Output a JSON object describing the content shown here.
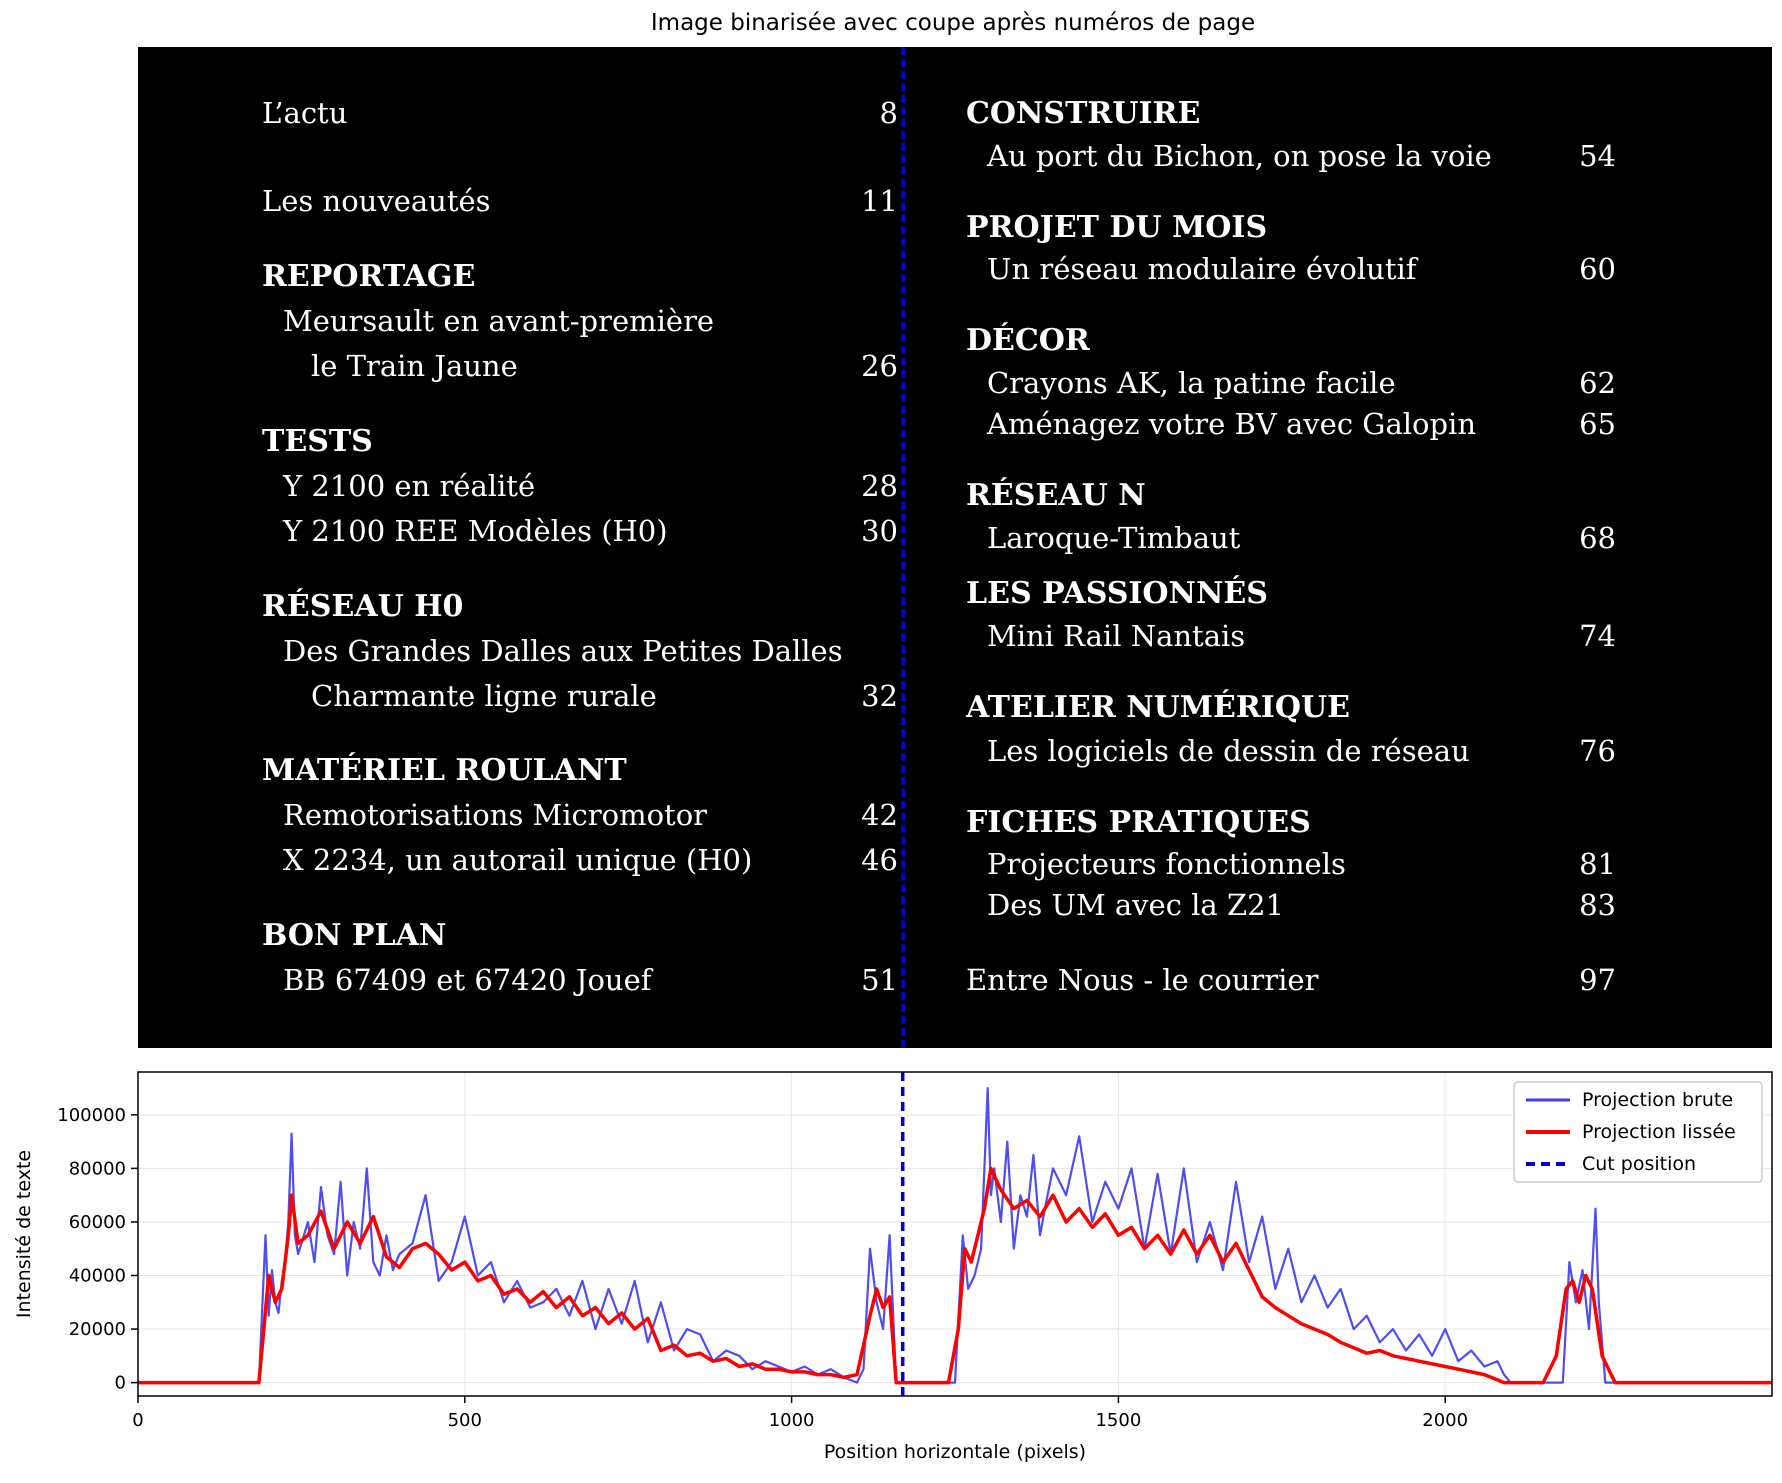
{
  "figure": {
    "title": "Image binarisée avec coupe après numéros de page"
  },
  "toc": {
    "left": [
      {
        "text": "L’actu",
        "page": "8",
        "kind": "item0"
      },
      {
        "text": "Les nouveautés",
        "page": "11",
        "kind": "item0"
      },
      {
        "text": "REPORTAGE",
        "page": "",
        "kind": "head"
      },
      {
        "text": "Meursault en avant-première",
        "page": "",
        "kind": "item1"
      },
      {
        "text": "le Train Jaune",
        "page": "26",
        "kind": "item2"
      },
      {
        "text": "TESTS",
        "page": "",
        "kind": "head"
      },
      {
        "text": "Y 2100 en réalité",
        "page": "28",
        "kind": "item1"
      },
      {
        "text": "Y 2100 REE Modèles (H0)",
        "page": "30",
        "kind": "item1"
      },
      {
        "text": "RÉSEAU H0",
        "page": "",
        "kind": "head"
      },
      {
        "text": "Des Grandes Dalles aux Petites Dalles",
        "page": "",
        "kind": "item1"
      },
      {
        "text": "Charmante ligne rurale",
        "page": "32",
        "kind": "item2"
      },
      {
        "text": "MATÉRIEL ROULANT",
        "page": "",
        "kind": "head"
      },
      {
        "text": "Remotorisations Micromotor",
        "page": "42",
        "kind": "item1"
      },
      {
        "text": "X 2234, un autorail unique (H0)",
        "page": "46",
        "kind": "item1"
      },
      {
        "text": "BON PLAN",
        "page": "",
        "kind": "head"
      },
      {
        "text": "BB 67409 et 67420 Jouef",
        "page": "51",
        "kind": "item1"
      }
    ],
    "right": [
      {
        "text": "CONSTRUIRE",
        "page": "",
        "kind": "head"
      },
      {
        "text": "Au port du Bichon, on pose la voie",
        "page": "54",
        "kind": "item1"
      },
      {
        "text": "PROJET DU MOIS",
        "page": "",
        "kind": "head"
      },
      {
        "text": "Un réseau modulaire évolutif",
        "page": "60",
        "kind": "item1"
      },
      {
        "text": "DÉCOR",
        "page": "",
        "kind": "head"
      },
      {
        "text": "Crayons AK, la patine facile",
        "page": "62",
        "kind": "item1"
      },
      {
        "text": "Aménagez votre BV avec Galopin",
        "page": "65",
        "kind": "item1"
      },
      {
        "text": "RÉSEAU N",
        "page": "",
        "kind": "head"
      },
      {
        "text": "Laroque-Timbaut",
        "page": "68",
        "kind": "item1"
      },
      {
        "text": "LES PASSIONNÉS",
        "page": "",
        "kind": "head"
      },
      {
        "text": "Mini Rail Nantais",
        "page": "74",
        "kind": "item1"
      },
      {
        "text": "ATELIER NUMÉRIQUE",
        "page": "",
        "kind": "head"
      },
      {
        "text": "Les logiciels de dessin de réseau",
        "page": "76",
        "kind": "item1"
      },
      {
        "text": "FICHES PRATIQUES",
        "page": "",
        "kind": "head"
      },
      {
        "text": "Projecteurs fonctionnels",
        "page": "81",
        "kind": "item1"
      },
      {
        "text": "Des UM avec la Z21",
        "page": "83",
        "kind": "item1"
      },
      {
        "text": "Entre Nous - le courrier",
        "page": "97",
        "kind": "item0"
      }
    ]
  },
  "chart_data": {
    "type": "line",
    "title": "",
    "xlabel": "Position horizontale (pixels)",
    "ylabel": "Intensité de texte",
    "xlim": [
      0,
      2500
    ],
    "ylim": [
      -5000,
      116000
    ],
    "xticks": [
      0,
      500,
      1000,
      1500,
      2000
    ],
    "yticks": [
      0,
      20000,
      40000,
      60000,
      80000,
      100000
    ],
    "grid": true,
    "legend_position": "top-right",
    "cut_position": 1170,
    "series": [
      {
        "name": "Projection brute",
        "color": "#3b3bf0",
        "x": [
          0,
          170,
          185,
          195,
          200,
          205,
          210,
          215,
          220,
          225,
          230,
          235,
          240,
          245,
          250,
          260,
          270,
          280,
          290,
          300,
          310,
          320,
          330,
          340,
          350,
          360,
          370,
          380,
          390,
          400,
          420,
          440,
          460,
          480,
          500,
          520,
          540,
          560,
          580,
          600,
          620,
          640,
          660,
          680,
          700,
          720,
          740,
          760,
          780,
          800,
          820,
          840,
          860,
          880,
          900,
          920,
          940,
          960,
          980,
          1000,
          1020,
          1040,
          1060,
          1080,
          1100,
          1110,
          1120,
          1130,
          1140,
          1150,
          1160,
          1170,
          1200,
          1250,
          1262,
          1270,
          1280,
          1290,
          1300,
          1305,
          1310,
          1320,
          1330,
          1340,
          1350,
          1360,
          1370,
          1380,
          1390,
          1400,
          1420,
          1440,
          1460,
          1480,
          1500,
          1520,
          1540,
          1560,
          1580,
          1600,
          1620,
          1640,
          1660,
          1680,
          1700,
          1720,
          1740,
          1760,
          1780,
          1800,
          1820,
          1840,
          1860,
          1880,
          1900,
          1920,
          1940,
          1960,
          1980,
          2000,
          2020,
          2040,
          2060,
          2080,
          2090,
          2100,
          2150,
          2180,
          2190,
          2200,
          2210,
          2220,
          2230,
          2235,
          2245,
          2260,
          2500
        ],
        "y": [
          0,
          0,
          0,
          55000,
          25000,
          42000,
          30000,
          26000,
          38000,
          45000,
          60000,
          93000,
          55000,
          48000,
          52000,
          60000,
          45000,
          73000,
          55000,
          48000,
          75000,
          40000,
          60000,
          50000,
          80000,
          45000,
          40000,
          55000,
          42000,
          48000,
          52000,
          70000,
          38000,
          45000,
          62000,
          40000,
          45000,
          30000,
          38000,
          28000,
          30000,
          35000,
          25000,
          38000,
          20000,
          35000,
          22000,
          38000,
          15000,
          30000,
          12000,
          20000,
          18000,
          8000,
          12000,
          10000,
          5000,
          8000,
          6000,
          4000,
          6000,
          3000,
          5000,
          2000,
          0,
          5000,
          50000,
          30000,
          20000,
          55000,
          0,
          0,
          0,
          0,
          55000,
          35000,
          40000,
          50000,
          110000,
          70000,
          80000,
          60000,
          90000,
          50000,
          70000,
          62000,
          85000,
          55000,
          68000,
          80000,
          70000,
          92000,
          60000,
          75000,
          65000,
          80000,
          50000,
          78000,
          48000,
          80000,
          45000,
          60000,
          42000,
          75000,
          45000,
          62000,
          35000,
          50000,
          30000,
          40000,
          28000,
          35000,
          20000,
          25000,
          15000,
          20000,
          12000,
          18000,
          10000,
          20000,
          8000,
          12000,
          6000,
          8000,
          3000,
          0,
          0,
          0,
          45000,
          30000,
          42000,
          20000,
          65000,
          30000,
          0,
          0,
          0
        ]
      },
      {
        "name": "Projection lissée",
        "color": "#ff0000",
        "x": [
          0,
          170,
          185,
          200,
          210,
          220,
          230,
          235,
          245,
          260,
          280,
          300,
          320,
          340,
          360,
          380,
          400,
          420,
          440,
          460,
          480,
          500,
          520,
          540,
          560,
          580,
          600,
          620,
          640,
          660,
          680,
          700,
          720,
          740,
          760,
          780,
          800,
          820,
          840,
          860,
          880,
          900,
          920,
          940,
          960,
          980,
          1000,
          1020,
          1040,
          1060,
          1080,
          1100,
          1120,
          1130,
          1140,
          1150,
          1160,
          1170,
          1200,
          1240,
          1255,
          1265,
          1275,
          1285,
          1295,
          1305,
          1320,
          1340,
          1360,
          1380,
          1400,
          1420,
          1440,
          1460,
          1480,
          1500,
          1520,
          1540,
          1560,
          1580,
          1600,
          1620,
          1640,
          1660,
          1680,
          1700,
          1720,
          1740,
          1760,
          1780,
          1800,
          1820,
          1840,
          1860,
          1880,
          1900,
          1920,
          1940,
          1960,
          1980,
          2000,
          2020,
          2040,
          2060,
          2080,
          2090,
          2150,
          2170,
          2185,
          2195,
          2205,
          2215,
          2225,
          2240,
          2260,
          2500
        ],
        "y": [
          0,
          0,
          0,
          40000,
          30000,
          35000,
          55000,
          70000,
          52000,
          55000,
          64000,
          50000,
          60000,
          52000,
          62000,
          47000,
          43000,
          50000,
          52000,
          48000,
          42000,
          45000,
          38000,
          40000,
          33000,
          35000,
          30000,
          34000,
          28000,
          32000,
          25000,
          28000,
          22000,
          26000,
          20000,
          24000,
          12000,
          14000,
          10000,
          11000,
          8000,
          9000,
          6000,
          7000,
          5000,
          5000,
          4000,
          4000,
          3000,
          3000,
          2000,
          3000,
          25000,
          35000,
          28000,
          32000,
          0,
          0,
          0,
          0,
          20000,
          50000,
          45000,
          55000,
          65000,
          80000,
          72000,
          65000,
          68000,
          62000,
          70000,
          60000,
          65000,
          58000,
          63000,
          55000,
          58000,
          50000,
          55000,
          48000,
          57000,
          48000,
          55000,
          45000,
          52000,
          42000,
          32000,
          28000,
          25000,
          22000,
          20000,
          18000,
          15000,
          13000,
          11000,
          12000,
          10000,
          9000,
          8000,
          7000,
          6000,
          5000,
          4000,
          3000,
          1000,
          0,
          0,
          10000,
          35000,
          38000,
          30000,
          40000,
          35000,
          10000,
          0,
          0
        ]
      }
    ]
  },
  "legend": {
    "raw": "Projection brute",
    "smooth": "Projection lissée",
    "cut": "Cut position"
  }
}
